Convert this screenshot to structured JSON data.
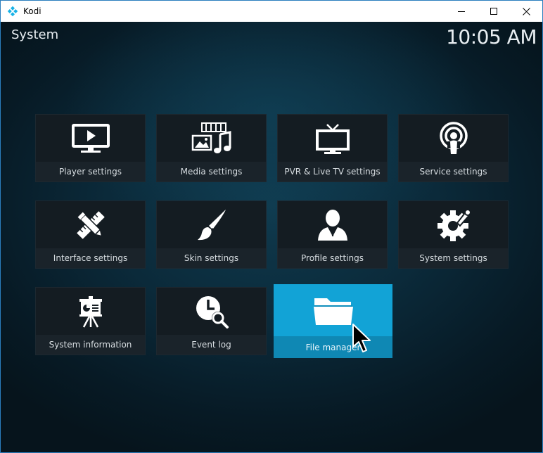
{
  "window": {
    "title": "Kodi",
    "icon": "kodi-logo-icon",
    "controls": [
      "minimize-icon",
      "maximize-icon",
      "close-icon"
    ]
  },
  "header": {
    "title": "System",
    "clock": "10:05 AM"
  },
  "tiles": [
    {
      "label": "Player settings",
      "icon": "monitor-play-icon"
    },
    {
      "label": "Media settings",
      "icon": "media-icon"
    },
    {
      "label": "PVR & Live TV settings",
      "icon": "tv-icon"
    },
    {
      "label": "Service settings",
      "icon": "podcast-broadcast-icon"
    },
    {
      "label": "Interface settings",
      "icon": "pencil-ruler-icon"
    },
    {
      "label": "Skin settings",
      "icon": "paintbrush-icon"
    },
    {
      "label": "Profile settings",
      "icon": "user-profile-icon"
    },
    {
      "label": "System settings",
      "icon": "gear-wrench-icon"
    },
    {
      "label": "System information",
      "icon": "presentation-easel-icon"
    },
    {
      "label": "Event log",
      "icon": "clock-search-icon"
    },
    {
      "label": "File manager",
      "icon": "folder-icon",
      "focused": true
    }
  ],
  "colors": {
    "background": "#0b2a3a",
    "tile": "#141c22",
    "tile_label_bar": "#1a232a",
    "focus": "#12a3d6",
    "text": "#e8eef2"
  }
}
